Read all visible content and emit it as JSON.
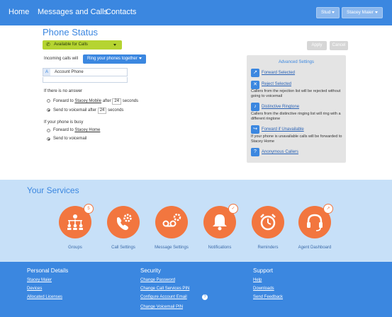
{
  "nav": {
    "home": "Home",
    "messages": "Messages and Calls",
    "contacts": "Contacts",
    "site_btn": "Stud",
    "user_btn": "Stacey Maier"
  },
  "phone_status": {
    "title": "Phone Status",
    "status": "Available for Calls",
    "incoming_label": "Incoming calls will",
    "incoming_value": "Ring your phones together",
    "account_letter": "A",
    "account_label": "Account Phone",
    "apply": "Apply",
    "cancel": "Cancel",
    "no_answer_heading": "If there is no answer",
    "no_answer_opt1_pre": "Forward to",
    "no_answer_opt1_link": "Stacey Mobile",
    "no_answer_opt1_after": "after",
    "no_answer_opt1_num": "24",
    "no_answer_opt1_unit": "seconds",
    "no_answer_opt2_pre": "Send to voicemail after",
    "no_answer_opt2_num": "24",
    "no_answer_opt2_unit": "seconds",
    "busy_heading": "If your phone is busy",
    "busy_opt1_pre": "Forward to",
    "busy_opt1_link": "Stacey Home",
    "busy_opt2": "Send to voicemail"
  },
  "advanced": {
    "title": "Advanced Settings",
    "items": [
      {
        "label": "Forward Selected",
        "icon": "forward-icon"
      },
      {
        "label": "Reject Selected",
        "icon": "reject-icon",
        "desc": "Callers from the rejection list will be rejected without going to voicemail"
      },
      {
        "label": "Distinctive Ringtone",
        "icon": "ringtone-icon",
        "desc": "Callers from the distinctive ringing list will ring with a different ringtone"
      },
      {
        "label": "Forward if Unavailable",
        "icon": "forward-unavailable-icon",
        "desc": "If your phone is unavailable calls will be forwarded to Stacey Home"
      },
      {
        "label": "Anonymous Callers",
        "icon": "anonymous-icon"
      }
    ]
  },
  "services": {
    "title": "Your Services",
    "items": [
      {
        "label": "Groups",
        "icon": "groups-icon",
        "badge": "5"
      },
      {
        "label": "Call Settings",
        "icon": "call-settings-icon"
      },
      {
        "label": "Message Settings",
        "icon": "message-settings-icon"
      },
      {
        "label": "Notifications",
        "icon": "notifications-icon",
        "badge": "✓"
      },
      {
        "label": "Reminders",
        "icon": "reminders-icon"
      },
      {
        "label": "Agent Dashboard",
        "icon": "agent-dashboard-icon",
        "badge": "↗"
      }
    ]
  },
  "footer": {
    "personal": {
      "heading": "Personal Details",
      "links": [
        "Stacey Maier",
        "Devices",
        "Allocated Licenses"
      ]
    },
    "security": {
      "heading": "Security",
      "links": [
        "Change Password",
        "Change Call Services PIN",
        "Configure Account Email",
        "Change Voicemail PIN"
      ]
    },
    "support": {
      "heading": "Support",
      "links": [
        "Help",
        "Downloads",
        "Send Feedback"
      ]
    }
  },
  "colors": {
    "accent": "#3b87e0",
    "status_green": "#b5d431",
    "service_orange": "#f2763f",
    "services_bg": "#c7e0f8"
  }
}
